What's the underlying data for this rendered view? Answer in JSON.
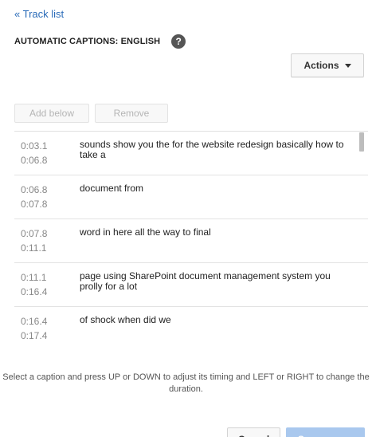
{
  "back_link": "« Track list",
  "track": {
    "title": "AUTOMATIC CAPTIONS: ENGLISH",
    "help_icon": "?"
  },
  "toolbar": {
    "actions_label": "Actions",
    "add_below_label": "Add below",
    "remove_label": "Remove"
  },
  "captions": [
    {
      "start": "0:03.1",
      "end": "0:06.8",
      "text": "sounds show you the for the website redesign basically how to take a"
    },
    {
      "start": "0:06.8",
      "end": "0:07.8",
      "text": "document from"
    },
    {
      "start": "0:07.8",
      "end": "0:11.1",
      "text": "word in here all the way to final"
    },
    {
      "start": "0:11.1",
      "end": "0:16.4",
      "text": "page using SharePoint document management system you prolly for a lot"
    },
    {
      "start": "0:16.4",
      "end": "0:17.4",
      "text": "of shock when did we"
    }
  ],
  "hint": "Select a caption and press UP or DOWN to adjust its timing and LEFT or RIGHT to change the duration.",
  "footer": {
    "cancel_label": "Cancel",
    "save_label": "Save a copy"
  },
  "colors": {
    "link": "#2a6bb8",
    "primary_disabled": "#a9c8ee"
  }
}
